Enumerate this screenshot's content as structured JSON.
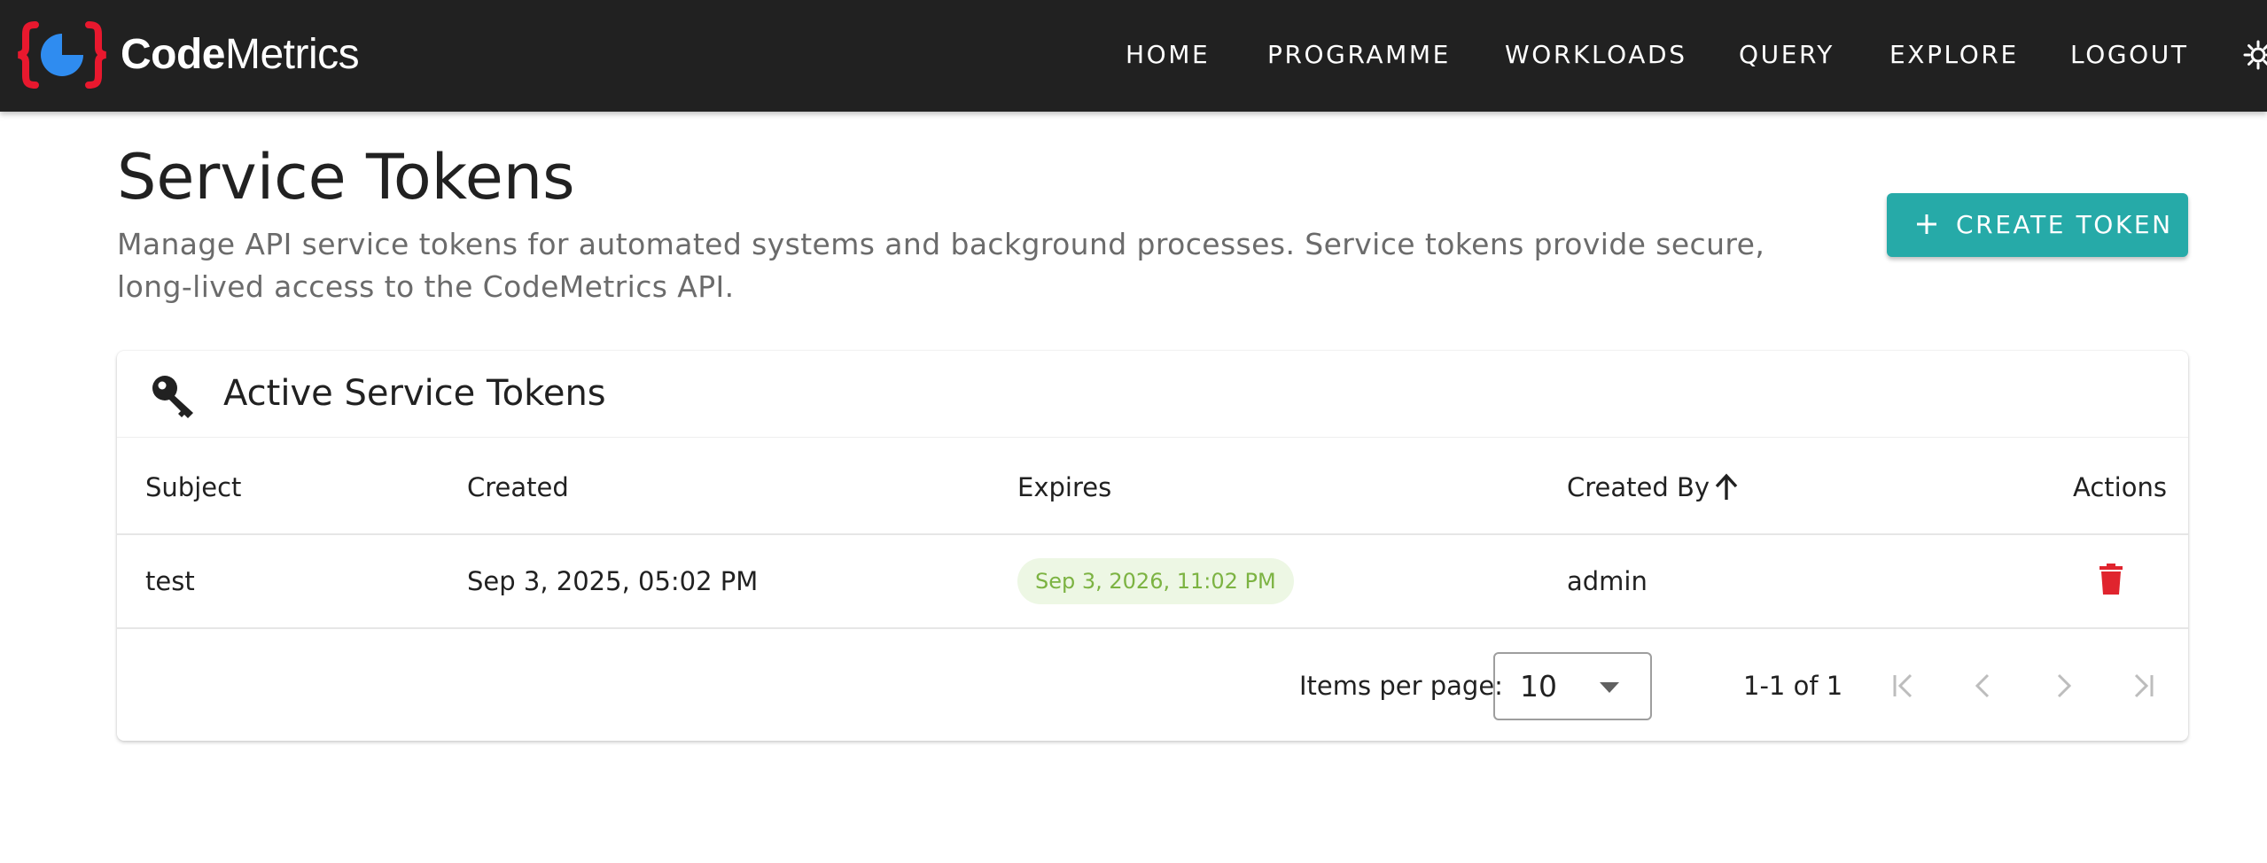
{
  "app": {
    "brand_bold": "Code",
    "brand_regular": "Metrics"
  },
  "nav": {
    "items": [
      {
        "label": "HOME"
      },
      {
        "label": "PROGRAMME"
      },
      {
        "label": "WORKLOADS"
      },
      {
        "label": "QUERY"
      },
      {
        "label": "EXPLORE"
      },
      {
        "label": "LOGOUT"
      }
    ],
    "trailing_icon": "settings-icon"
  },
  "header": {
    "title": "Service Tokens",
    "description": "Manage API service tokens for automated systems and background processes. Service tokens provide secure, long-lived access to the CodeMetrics API.",
    "create_button": {
      "icon": "plus-icon",
      "label": "CREATE TOKEN"
    }
  },
  "card": {
    "icon": "key-icon",
    "title": "Active Service Tokens"
  },
  "table": {
    "columns": [
      {
        "label": "Subject"
      },
      {
        "label": "Created"
      },
      {
        "label": "Expires"
      },
      {
        "label": "Created By",
        "sort": "ascending"
      },
      {
        "label": "Actions"
      }
    ],
    "rows": [
      {
        "subject": "test",
        "created": "Sep 3, 2025, 05:02 PM",
        "expires": "Sep 3, 2026, 11:02 PM",
        "created_by": "admin",
        "action_icon": "delete-icon"
      }
    ]
  },
  "paginator": {
    "items_per_page_label": "Items per page:",
    "page_size": "10",
    "range": "1-1 of 1"
  },
  "colors": {
    "topbar": "#212121",
    "accent": "#26aaa8",
    "logo_red": "#e8182e",
    "logo_blue": "#2f8cf0",
    "chip_bg": "#edf7e4",
    "chip_text": "#7cb342",
    "delete": "#e0242e"
  }
}
